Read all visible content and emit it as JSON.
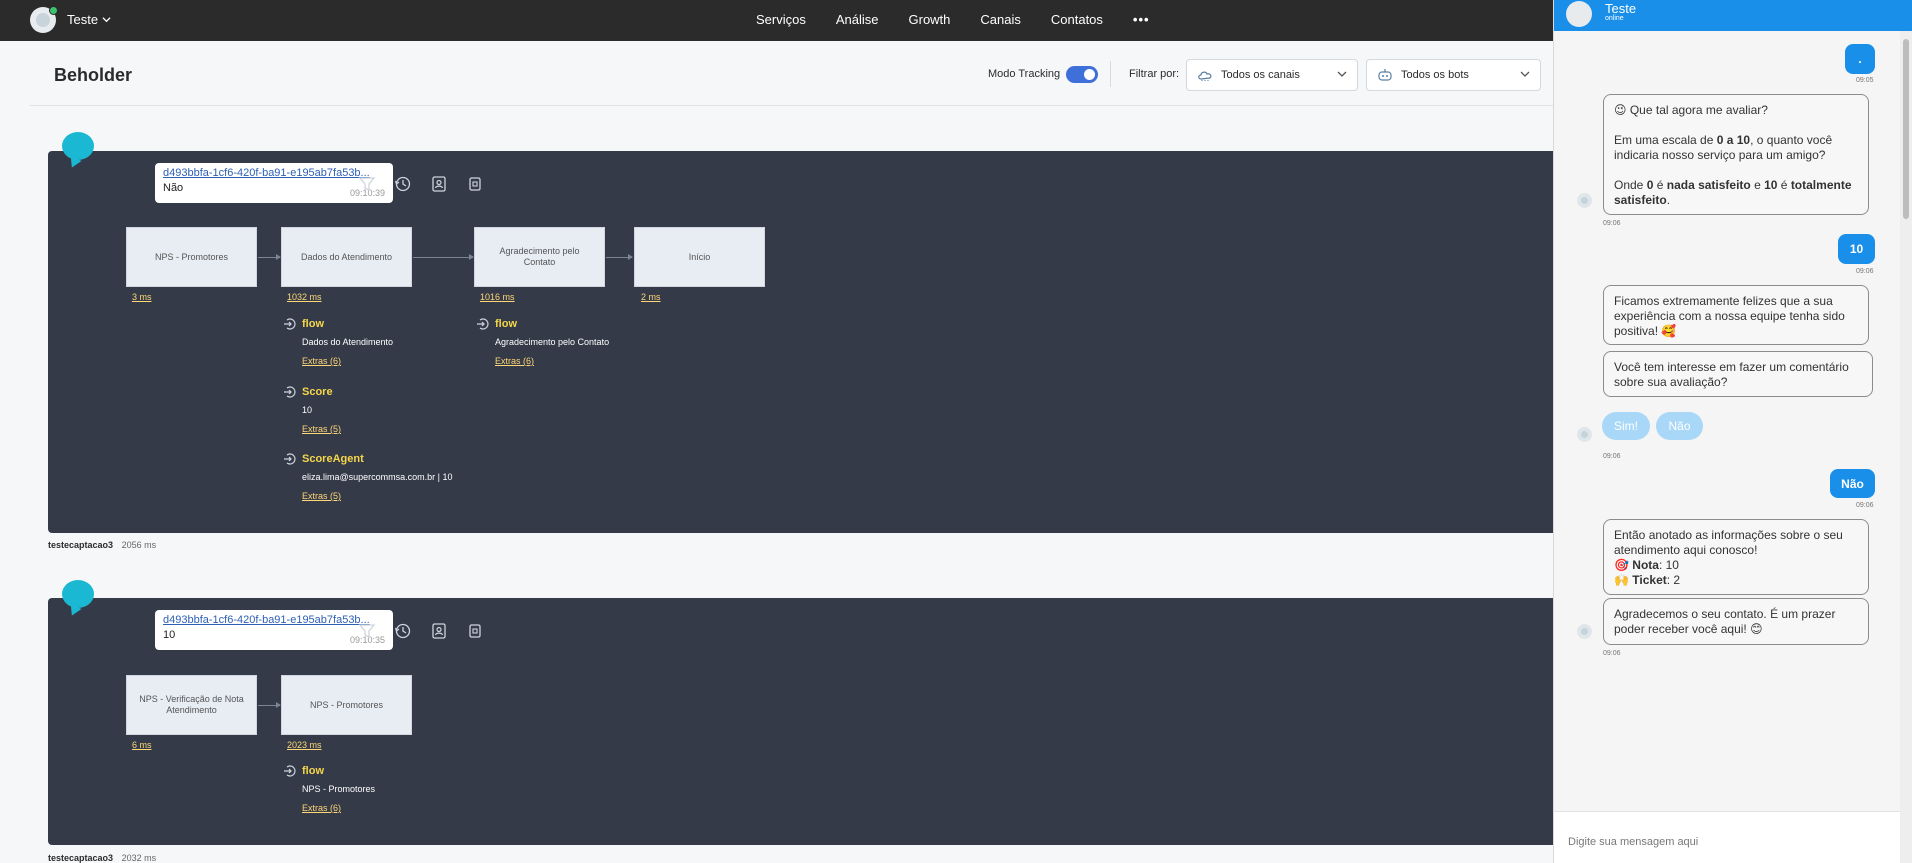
{
  "nav": {
    "workspace": "Teste",
    "items": [
      "Serviços",
      "Análise",
      "Growth",
      "Canais",
      "Contatos"
    ],
    "more": "•••"
  },
  "header": {
    "title": "Beholder",
    "tracking_label": "Modo Tracking",
    "tracking_on": true,
    "filter_label": "Filtrar por:",
    "channel_filter": "Todos os canais",
    "bot_filter": "Todos os bots"
  },
  "traces": [
    {
      "message_id": "d493bbfa-1cf6-420f-ba91-e195ab7fa53b...",
      "message_text": "Não",
      "message_time": "09:10:39",
      "nodes": [
        {
          "label": "NPS - Promotores",
          "ms": "3 ms"
        },
        {
          "label": "Dados do Atendimento",
          "ms": "1032 ms"
        },
        {
          "label": "Agradecimento pelo Contato",
          "ms": "1016 ms"
        },
        {
          "label": "Início",
          "ms": "2 ms"
        }
      ],
      "events_col1": [
        {
          "name": "flow",
          "value": "Dados do Atendimento",
          "extras": "Extras (6)"
        },
        {
          "name": "Score",
          "value": "10",
          "extras": "Extras (5)"
        },
        {
          "name": "ScoreAgent",
          "value": "eliza.lima@supercommsa.com.br | 10",
          "extras": "Extras (5)"
        }
      ],
      "events_col2": [
        {
          "name": "flow",
          "value": "Agradecimento pelo Contato",
          "extras": "Extras (6)"
        }
      ],
      "footer_bot": "testecaptacao3",
      "footer_ms": "2056 ms"
    },
    {
      "message_id": "d493bbfa-1cf6-420f-ba91-e195ab7fa53b...",
      "message_text": "10",
      "message_time": "09:10:35",
      "nodes": [
        {
          "label": "NPS - Verificação de Nota Atendimento",
          "ms": "6 ms"
        },
        {
          "label": "NPS - Promotores",
          "ms": "2023 ms"
        }
      ],
      "events_col1": [
        {
          "name": "flow",
          "value": "NPS - Promotores",
          "extras": "Extras (6)"
        }
      ],
      "footer_bot": "testecaptacao3",
      "footer_ms": "2032 ms"
    }
  ],
  "chat": {
    "name": "Teste",
    "status": "online",
    "messages": {
      "user_dot": ".",
      "user_dot_time": "09:05",
      "bot_eval_q": "😉 Que tal agora me avaliar?",
      "bot_eval_scale_1": "Em uma escala de ",
      "bot_eval_scale_b1": "0 a 10",
      "bot_eval_scale_2": ", o quanto você indicaria nosso serviço para um amigo?",
      "bot_eval_where_1": "Onde ",
      "bot_eval_where_b1": "0",
      "bot_eval_where_2": " é ",
      "bot_eval_where_b2": "nada satisfeito",
      "bot_eval_where_3": " e ",
      "bot_eval_where_b3": "10",
      "bot_eval_where_4": " é ",
      "bot_eval_where_b4": "totalmente satisfeito",
      "bot_eval_where_5": ".",
      "bot_eval_time": "09:06",
      "user_10": "10",
      "user_10_time": "09:06",
      "bot_happy": "Ficamos extremamente felizes que a sua experiência com a nossa equipe tenha sido positiva! 🥰",
      "bot_comment": "Você tem interesse em fazer um comentário sobre sua avaliação?",
      "qr_yes": "Sim!",
      "qr_no": "Não",
      "qr_time": "09:06",
      "user_nao": "Não",
      "user_nao_time": "09:06",
      "bot_summary_1": "Então anotado as informações sobre o seu atendimento aqui conosco!",
      "bot_summary_nota_label": "Nota",
      "bot_summary_nota_val": ": 10",
      "bot_summary_ticket_label": "Ticket",
      "bot_summary_ticket_val": ": 2",
      "bot_thanks": "Agradecemos o seu contato. É um prazer poder receber você aqui! 😊",
      "bot_thanks_time": "09:06"
    },
    "input_placeholder": "Digite sua mensagem aqui"
  }
}
